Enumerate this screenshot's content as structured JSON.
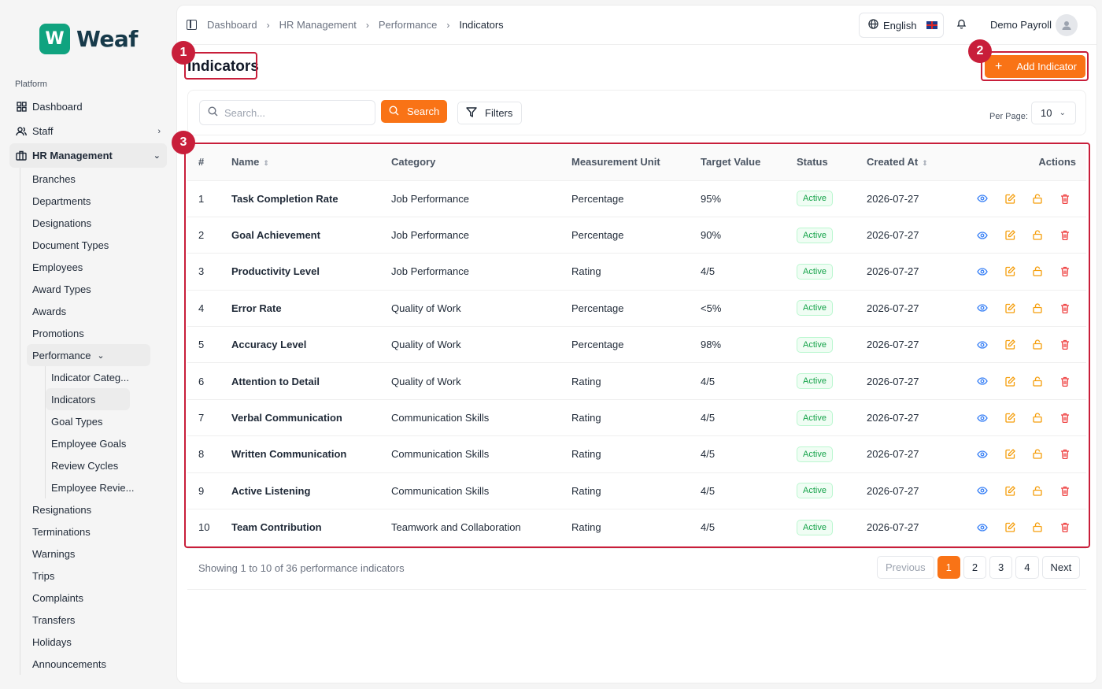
{
  "brand": {
    "logo_letter": "W",
    "name": "Weaf",
    "color": "#10a37f"
  },
  "sidebar": {
    "section_label": "Platform",
    "top_items": [
      {
        "label": "Dashboard",
        "icon": "grid-icon"
      },
      {
        "label": "Staff",
        "icon": "users-icon"
      },
      {
        "label": "HR Management",
        "icon": "briefcase-icon"
      }
    ],
    "hr_items": [
      "Branches",
      "Departments",
      "Designations",
      "Document Types",
      "Employees",
      "Award Types",
      "Awards",
      "Promotions"
    ],
    "performance_label": "Performance",
    "performance_items": [
      "Indicator Categ...",
      "Indicators",
      "Goal Types",
      "Employee Goals",
      "Review Cycles",
      "Employee Revie..."
    ],
    "after_items": [
      "Resignations",
      "Terminations",
      "Warnings",
      "Trips",
      "Complaints",
      "Transfers",
      "Holidays",
      "Announcements"
    ]
  },
  "breadcrumb": [
    "Dashboard",
    "HR Management",
    "Performance",
    "Indicators"
  ],
  "header": {
    "language": "English",
    "user_name": "Demo Payroll"
  },
  "page": {
    "title": "Indicators",
    "add_button": "Add Indicator"
  },
  "filters": {
    "search_placeholder": "Search...",
    "search_button": "Search",
    "filters_button": "Filters",
    "per_page_label": "Per Page:",
    "per_page_value": "10"
  },
  "table": {
    "headers": [
      "#",
      "Name",
      "Category",
      "Measurement Unit",
      "Target Value",
      "Status",
      "Created At",
      "Actions"
    ],
    "rows": [
      {
        "idx": "1",
        "name": "Task Completion Rate",
        "category": "Job Performance",
        "unit": "Percentage",
        "target": "95%",
        "status": "Active",
        "created": "2026-07-27"
      },
      {
        "idx": "2",
        "name": "Goal Achievement",
        "category": "Job Performance",
        "unit": "Percentage",
        "target": "90%",
        "status": "Active",
        "created": "2026-07-27"
      },
      {
        "idx": "3",
        "name": "Productivity Level",
        "category": "Job Performance",
        "unit": "Rating",
        "target": "4/5",
        "status": "Active",
        "created": "2026-07-27"
      },
      {
        "idx": "4",
        "name": "Error Rate",
        "category": "Quality of Work",
        "unit": "Percentage",
        "target": "<5%",
        "status": "Active",
        "created": "2026-07-27"
      },
      {
        "idx": "5",
        "name": "Accuracy Level",
        "category": "Quality of Work",
        "unit": "Percentage",
        "target": "98%",
        "status": "Active",
        "created": "2026-07-27"
      },
      {
        "idx": "6",
        "name": "Attention to Detail",
        "category": "Quality of Work",
        "unit": "Rating",
        "target": "4/5",
        "status": "Active",
        "created": "2026-07-27"
      },
      {
        "idx": "7",
        "name": "Verbal Communication",
        "category": "Communication Skills",
        "unit": "Rating",
        "target": "4/5",
        "status": "Active",
        "created": "2026-07-27"
      },
      {
        "idx": "8",
        "name": "Written Communication",
        "category": "Communication Skills",
        "unit": "Rating",
        "target": "4/5",
        "status": "Active",
        "created": "2026-07-27"
      },
      {
        "idx": "9",
        "name": "Active Listening",
        "category": "Communication Skills",
        "unit": "Rating",
        "target": "4/5",
        "status": "Active",
        "created": "2026-07-27"
      },
      {
        "idx": "10",
        "name": "Team Contribution",
        "category": "Teamwork and Collaboration",
        "unit": "Rating",
        "target": "4/5",
        "status": "Active",
        "created": "2026-07-27"
      }
    ]
  },
  "footer": {
    "summary": "Showing 1 to 10 of 36 performance indicators",
    "prev": "Previous",
    "pages": [
      "1",
      "2",
      "3",
      "4"
    ],
    "next": "Next"
  },
  "callouts": [
    "1",
    "2",
    "3"
  ],
  "colors": {
    "accent": "#f97316",
    "callout": "#c81e3a",
    "active_badge": "#16a34a"
  }
}
